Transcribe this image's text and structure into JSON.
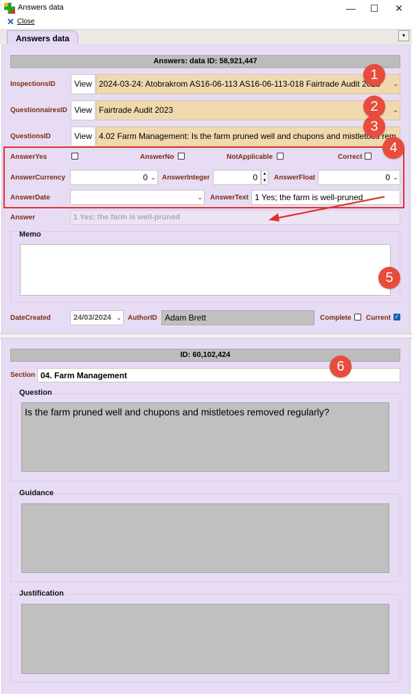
{
  "window": {
    "title": "Answers data",
    "controls": {
      "minimize": "—",
      "maximize": "☐",
      "close": "✕"
    }
  },
  "menu": {
    "close_label": "Close"
  },
  "tab": {
    "label": "Answers data",
    "dropdown": "▾"
  },
  "answer": {
    "header": "Answers: data ID: 58,921,447",
    "inspections": {
      "label": "InspectionsID",
      "view": "View",
      "value": "2024-03-24: Atobrakrom AS16-06-113 AS16-06-113-018 Fairtrade Audit 2023"
    },
    "questionnaires": {
      "label": "QuestionnairesID",
      "view": "View",
      "value": "Fairtrade Audit 2023"
    },
    "questions": {
      "label": "QuestionsID",
      "view": "View",
      "value": "4.02 Farm Management: Is the farm pruned well and chupons and mistletoes rem"
    },
    "answer_yes": {
      "label": "AnswerYes"
    },
    "answer_no": {
      "label": "AnswerNo"
    },
    "not_applicable": {
      "label": "NotApplicable"
    },
    "correct": {
      "label": "Correct"
    },
    "answer_currency": {
      "label": "AnswerCurrency",
      "value": "0"
    },
    "answer_integer": {
      "label": "AnswerInteger",
      "value": "0"
    },
    "answer_float": {
      "label": "AnswerFloat",
      "value": "0"
    },
    "answer_date": {
      "label": "AnswerDate",
      "value": ""
    },
    "answer_text": {
      "label": "AnswerText",
      "value": "1 Yes; the farm is well-pruned"
    },
    "answer_field": {
      "label": "Answer",
      "value": "1 Yes; the farm is well-pruned"
    },
    "memo": {
      "label": "Memo",
      "value": ""
    },
    "date_created": {
      "label": "DateCreated",
      "value": "24/03/2024"
    },
    "author": {
      "label": "AuthorID",
      "value": "Adam Brett"
    },
    "complete": {
      "label": "Complete",
      "checked": false
    },
    "current": {
      "label": "Current",
      "checked": true
    }
  },
  "question": {
    "header": "ID: 60,102,424",
    "section": {
      "label": "Section",
      "value": "04. Farm Management"
    },
    "question": {
      "label": "Question",
      "value": "Is the farm pruned well and chupons and mistletoes removed regularly?"
    },
    "guidance": {
      "label": "Guidance",
      "value": ""
    },
    "justification": {
      "label": "Justification",
      "value": ""
    }
  },
  "markers": [
    "1",
    "2",
    "3",
    "4",
    "5",
    "6"
  ],
  "colors": {
    "panel": "#e7dcf4",
    "combo": "#f0d9ae",
    "label": "#7b2d14",
    "marker": "#e74c3c",
    "highlight_box": "#e0302a"
  }
}
